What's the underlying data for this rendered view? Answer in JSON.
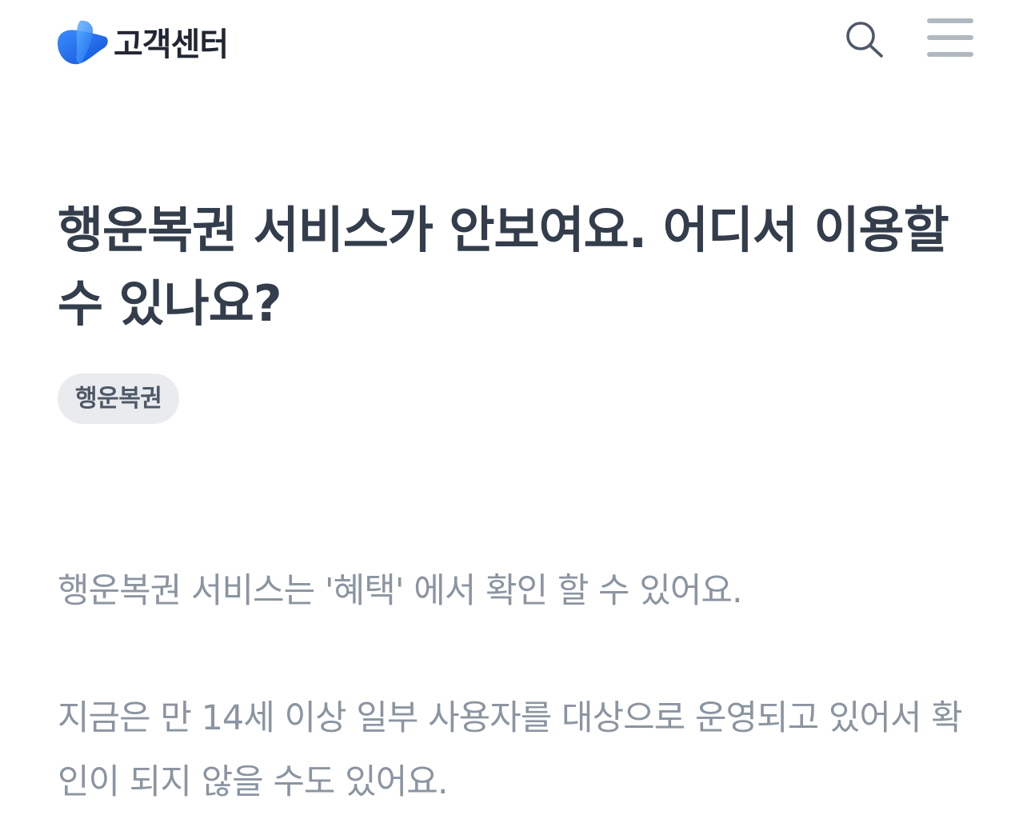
{
  "header": {
    "brand_name": "고객센터",
    "brand_color": "#1b64da",
    "search_icon": "search-icon",
    "menu_icon": "hamburger-menu-icon"
  },
  "article": {
    "title": "행운복권 서비스가 안보여요. 어디서 이용할 수 있나요?",
    "tag": "행운복권",
    "paragraphs": [
      "행운복권 서비스는 '혜택' 에서 확인 할 수 있어요.",
      "지금은 만 14세 이상 일부 사용자를 대상으로 운영되고 있어서 확인이 되지 않을 수도 있어요."
    ]
  },
  "colors": {
    "title": "#333d4b",
    "body": "#8b95a1",
    "tag_bg": "#eaebee",
    "icon": "#4e5968",
    "menu_icon": "#b0b8c1"
  }
}
